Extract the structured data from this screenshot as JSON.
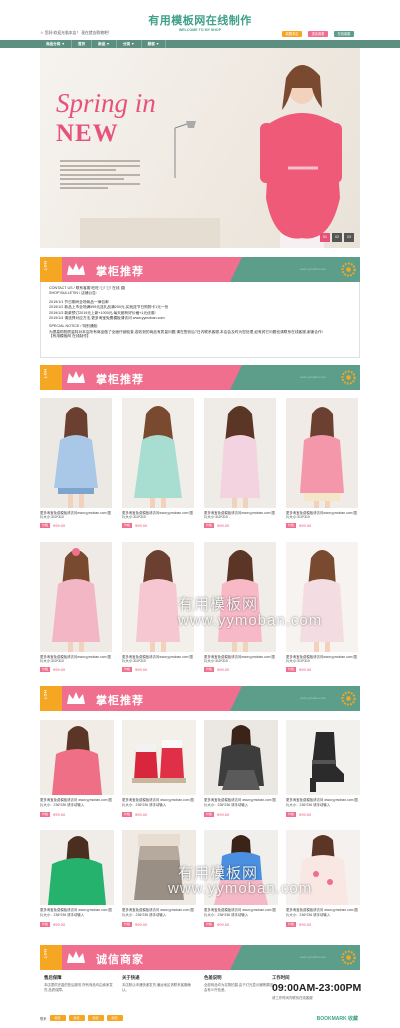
{
  "site": {
    "title": "有用模板网在线制作",
    "subtitle": "WELCOME TO MY SHOP",
    "welcome": "☺ 您好!欢迎光临本店！ 现在就去购物吧！",
    "buttons": [
      "收藏本店",
      "进店看看",
      "在线客服"
    ]
  },
  "nav": [
    "商品分类 ▼",
    "首页",
    "新品 ▼",
    "分类 ▼",
    "服装 ▼"
  ],
  "banner": {
    "title1": "Spring in",
    "title2": "NEW",
    "dots": [
      "01",
      "02",
      "03"
    ]
  },
  "sections": [
    {
      "hot": "HOT",
      "title": "掌柜推荐",
      "sub": "www.yymoban.com"
    },
    {
      "hot": "HOT",
      "title": "掌柜推荐",
      "sub": "www.yymoban.com"
    },
    {
      "hot": "HOT",
      "title": "掌柜推荐",
      "sub": "www.yymoban.com"
    },
    {
      "hot": "HOT",
      "title": "诚信商家",
      "sub": "www.yymoban.com"
    }
  ],
  "notice": {
    "lines": [
      "CONTACT US / 联系客服:旺旺: 💬 💬 在线 🖨",
      "SHOP BULLETIN / 店铺公告:",
      "2019/1/1   节日期间全场商品一律包邮",
      "2019/1/2   新品上市全场满599元送礼品满200元,买就送节日购物卡1元一份",
      "2019/1/3   新款预订2019元上新+1000元,每天都有好价格+1元优惠!",
      "2019/1/4   请选择对应方法,更多淘宝免费模板请访问 www.yymoban.com",
      "SPECIAL NOTICE / 特别通知:",
      "为提高购物质量特对本店所有商品做了全面仔细检查,若收到的商品有质量问题,请在签收后7日内联系客服,本店会及时为您处理,如有其它问题也请联系在线客服,谢谢合作!",
      "【有用模板网 在线制作】"
    ]
  },
  "products_big": [
    {
      "name": "更多淘宝免费模板请访问www.yymoban.com 图片大小:310*310",
      "tag": "价格",
      "price": "999.00"
    },
    {
      "name": "更多淘宝免费模板请访问www.yymoban.com 图片大小:310*310",
      "tag": "价格",
      "price": "999.00"
    },
    {
      "name": "更多淘宝免费模板请访问www.yymoban.com 图片大小:310*310",
      "tag": "价格",
      "price": "999.00"
    },
    {
      "name": "更多淘宝免费模板请访问www.yymoban.com 图片大小:310*310",
      "tag": "价格",
      "price": "999.00"
    },
    {
      "name": "更多淘宝免费模板请访问www.yymoban.com 图片大小:310*310",
      "tag": "价格",
      "price": "999.00"
    },
    {
      "name": "更多淘宝免费模板请访问www.yymoban.com 图片大小:310*310",
      "tag": "价格",
      "price": "999.00"
    },
    {
      "name": "更多淘宝免费模板请访问www.yymoban.com 图片大小:310*310",
      "tag": "价格",
      "price": "999.00"
    },
    {
      "name": "更多淘宝免费模板请访问www.yymoban.com 图片大小:310*310",
      "tag": "价格",
      "price": "999.00"
    }
  ],
  "products_small": [
    {
      "name": "更多淘宝免费模板请访问 www.yymoban.com 图片大小：236*236 请手动输入",
      "tag": "价格",
      "price": "999.00"
    },
    {
      "name": "更多淘宝免费模板请访问 www.yymoban.com 图片大小：236*236 请手动输入",
      "tag": "价格",
      "price": "999.00"
    },
    {
      "name": "更多淘宝免费模板请访问 www.yymoban.com 图片大小：236*236 请手动输入",
      "tag": "价格",
      "price": "999.00"
    },
    {
      "name": "更多淘宝免费模板请访问 www.yymoban.com 图片大小：236*236 请手动输入",
      "tag": "价格",
      "price": "999.00"
    },
    {
      "name": "更多淘宝免费模板请访问 www.yymoban.com 图片大小：236*236 请手动输入",
      "tag": "价格",
      "price": "999.00"
    },
    {
      "name": "更多淘宝免费模板请访问 www.yymoban.com 图片大小：236*236 请手动输入",
      "tag": "价格",
      "price": "999.00"
    },
    {
      "name": "更多淘宝免费模板请访问 www.yymoban.com 图片大小：236*236 请手动输入",
      "tag": "价格",
      "price": "999.00"
    },
    {
      "name": "更多淘宝免费模板请访问 www.yymoban.com 图片大小：236*236 请手动输入",
      "tag": "价格",
      "price": "999.00"
    }
  ],
  "watermark": {
    "line1": "有用模板网",
    "line2": "www.yymoban.com"
  },
  "footer": {
    "cols": [
      {
        "h": "售后保障",
        "b": "本店提供完善的售后服务,所有商品均由卖家发货,品质保障。"
      },
      {
        "h": "关于快递",
        "b": "本店默认申通快递发货,偏远地区请联系客服确认。"
      },
      {
        "h": "色差说明",
        "b": "全部商品均为实物拍摄,由于灯光显示器等原因会有少许色差。"
      },
      {
        "h": "工作时间",
        "b": "09:00AM-23:00PM",
        "note": "请工作时间内联系在线客服"
      }
    ],
    "links": [
      "联系",
      "旺旺",
      "旺旺",
      "旺旺",
      "旺旺"
    ],
    "bookmark": "BOOKMARK 收藏"
  },
  "colors": {
    "teal": "#5c8f80",
    "pink": "#f06e8e",
    "orange": "#f5a623",
    "title": "#3fa08a"
  }
}
